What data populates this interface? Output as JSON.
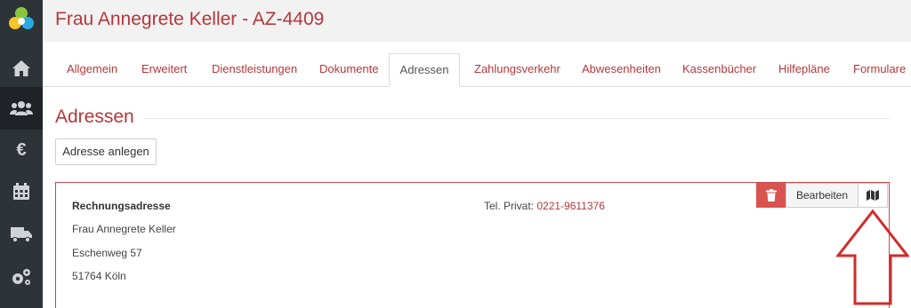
{
  "header": {
    "title": "Frau Annegrete Keller - AZ-4409"
  },
  "sidebar": {
    "items": [
      {
        "icon": "home-icon"
      },
      {
        "icon": "users-icon",
        "active": true
      },
      {
        "icon": "euro-icon"
      },
      {
        "icon": "calendar-icon"
      },
      {
        "icon": "truck-icon"
      },
      {
        "icon": "gears-icon"
      }
    ]
  },
  "tabs": [
    {
      "label": "Allgemein"
    },
    {
      "label": "Erweitert"
    },
    {
      "label": "Dienstleistungen"
    },
    {
      "label": "Dokumente"
    },
    {
      "label": "Adressen",
      "active": true
    },
    {
      "label": "Zahlungsverkehr"
    },
    {
      "label": "Abwesenheiten"
    },
    {
      "label": "Kassenbücher"
    },
    {
      "label": "Hilfepläne"
    },
    {
      "label": "Formulare"
    }
  ],
  "section": {
    "title": "Adressen",
    "add_button": "Adresse anlegen"
  },
  "address": {
    "heading": "Rechnungsadresse",
    "name": "Frau Annegrete Keller",
    "street": "Eschenweg 57",
    "city": "51764 Köln",
    "phone_label": "Tel. Privat:",
    "phone_number": "0221-9611376",
    "edit_button": "Bearbeiten"
  },
  "colors": {
    "accent": "#b5373a",
    "sidebar": "#2e3338",
    "delete": "#d9534f"
  }
}
